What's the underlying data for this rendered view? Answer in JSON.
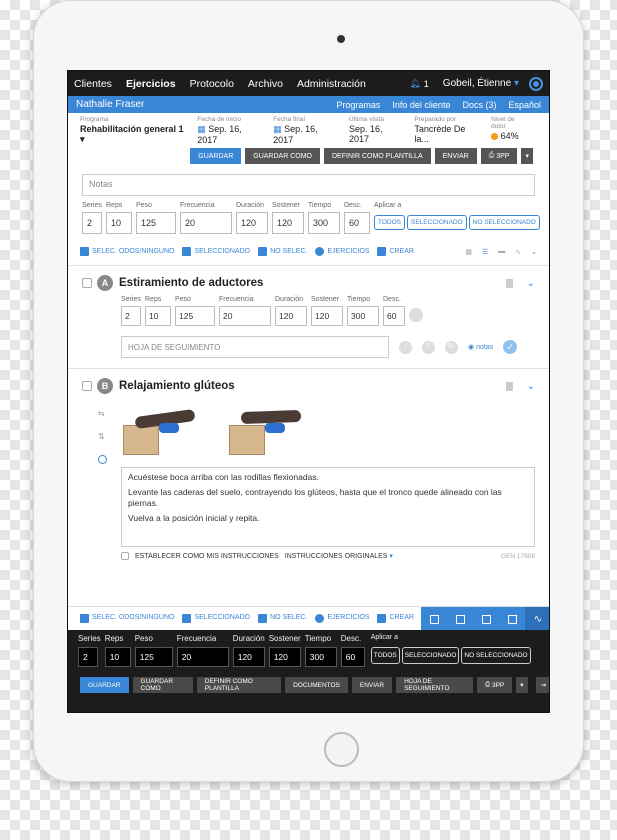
{
  "topnav": {
    "items": [
      "Clientes",
      "Ejercicios",
      "Protocolo",
      "Archivo",
      "Administración"
    ],
    "active": "Ejercicios",
    "notif_count": "1",
    "user": "Gobeil, Étienne"
  },
  "client": {
    "name": "Nathalie Fraser",
    "links": [
      "Programas",
      "Info del cliente",
      "Docs (3)",
      "Español"
    ]
  },
  "info": {
    "program_label": "Programa",
    "program": "Rehabilitación general 1",
    "start_label": "Fecha de inicio",
    "start": "Sep. 16, 2017",
    "end_label": "Fecha final",
    "end": "Sep. 16, 2017",
    "last_label": "Última visita",
    "last": "Sep. 16, 2017",
    "prep_label": "Preparado por",
    "prep": "Tancrède De la...",
    "pain_label": "Nivel de dolor",
    "pain": "64%"
  },
  "actions": {
    "save": "Guardar",
    "save_as": "Guardar como",
    "template": "Definir como plantilla",
    "send": "Enviar",
    "print": "3PP"
  },
  "notes_placeholder": "Notas",
  "params": {
    "labels": [
      "Series",
      "Reps",
      "Peso",
      "Frecuencia",
      "Duración",
      "Sostener",
      "Tiempo",
      "Desc."
    ],
    "values": [
      "2",
      "10",
      "125",
      "20",
      "120",
      "120",
      "300",
      "60"
    ],
    "apply_label": "Aplicar a",
    "apply": [
      "Todos",
      "Seleccionado",
      "No seleccionado"
    ]
  },
  "tools": {
    "select_all": "Selec. odos/ninguno",
    "selected": "Seleccionado",
    "not_selected": "No selec.",
    "exercises": "Ejercicios",
    "create": "Crear"
  },
  "ex_a": {
    "letter": "A",
    "title": "Estiramiento de aductores",
    "tracking": "Hoja de seguimiento",
    "notes": "notas",
    "circles": [
      "I",
      "D",
      "BL"
    ]
  },
  "ex_b": {
    "letter": "B",
    "title": "Relajamiento glúteos",
    "desc": [
      "Acuéstese boca arriba con las rodillas flexionadas.",
      "Levante las caderas del suelo, contrayendo los glúteos, hasta que el tronco quede alineado con las piernas.",
      "Vuelva a la posición inicial y repita."
    ],
    "set_mine": "Establecer como mis instrucciones",
    "original": "Instrucciones originales",
    "gen": "GEN 17908"
  },
  "bottom": {
    "tracking": "Hoja de seguimiento",
    "documents": "Documentos"
  }
}
